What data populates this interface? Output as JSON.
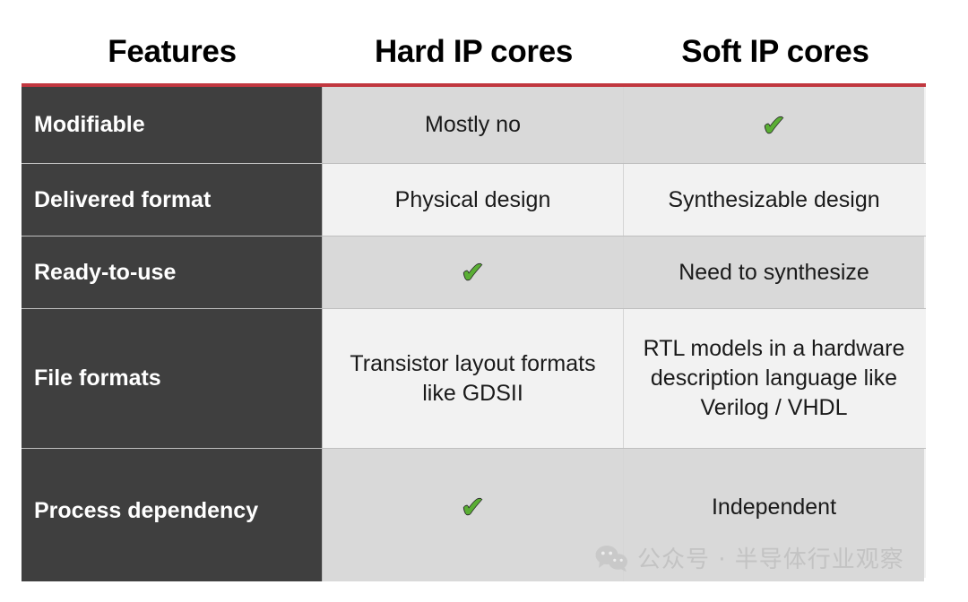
{
  "table": {
    "headers": [
      "Features",
      "Hard IP cores",
      "Soft IP cores"
    ],
    "accent_color": "#c1373f",
    "feature_column_color": "#3f3f3f",
    "check_color": "#5aae34",
    "check_glyph": "✔",
    "rows": [
      {
        "feature": "Modifiable",
        "hard": "Mostly no",
        "soft": "check-mark"
      },
      {
        "feature": "Delivered format",
        "hard": "Physical design",
        "soft": "Synthesizable design"
      },
      {
        "feature": "Ready-to-use",
        "hard": "check-mark",
        "soft": "Need to synthesize"
      },
      {
        "feature": "File formats",
        "hard": "Transistor layout formats like GDSII",
        "soft": "RTL models in a hardware description language like Verilog / VHDL"
      },
      {
        "feature": "Process dependency",
        "hard": "check-mark",
        "soft": "Independent"
      }
    ]
  },
  "watermark": {
    "text": "公众号 · 半导体行业观察",
    "icon": "wechat-icon",
    "color": "#c3c3c3"
  }
}
